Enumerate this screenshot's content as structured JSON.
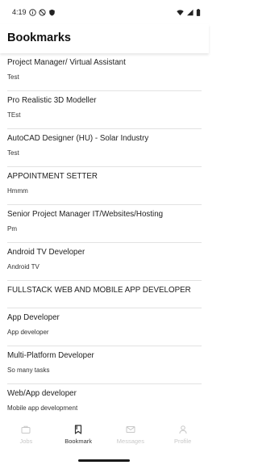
{
  "status_bar": {
    "time": "4:19"
  },
  "header": {
    "title": "Bookmarks"
  },
  "bookmarks": [
    {
      "title": "Project Manager/ Virtual Assistant",
      "subtitle": "Test"
    },
    {
      "title": "Pro Realistic 3D Modeller",
      "subtitle": "TEst"
    },
    {
      "title": "AutoCAD Designer (HU) - Solar Industry",
      "subtitle": "Test"
    },
    {
      "title": "APPOINTMENT SETTER",
      "subtitle": "Hmmm"
    },
    {
      "title": "Senior Project Manager IT/Websites/Hosting",
      "subtitle": "Pm"
    },
    {
      "title": "Android TV Developer",
      "subtitle": "Android TV"
    },
    {
      "title": "FULLSTACK WEB AND MOBILE APP DEVELOPER",
      "subtitle": ""
    },
    {
      "title": "App Developer",
      "subtitle": "App developer"
    },
    {
      "title": "Multi-Platform Developer",
      "subtitle": "So many tasks"
    },
    {
      "title": "Web/App developer",
      "subtitle": "Mobile app development"
    }
  ],
  "bottom_nav": {
    "items": [
      {
        "label": "Jobs",
        "icon": "briefcase-icon",
        "active": false
      },
      {
        "label": "Bookmark",
        "icon": "bookmark-icon",
        "active": true
      },
      {
        "label": "Messages",
        "icon": "envelope-icon",
        "active": false
      },
      {
        "label": "Profile",
        "icon": "person-icon",
        "active": false
      }
    ]
  },
  "colors": {
    "active": "#333333",
    "inactive": "#c8c8c8",
    "divider": "#e2e2e2"
  }
}
